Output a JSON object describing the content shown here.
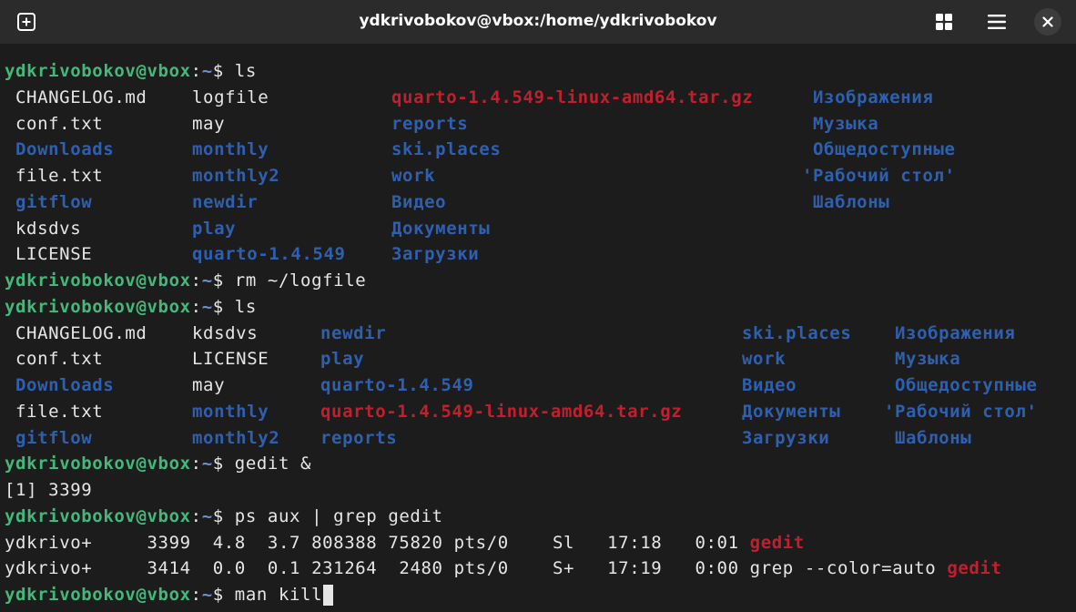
{
  "window": {
    "title": "ydkrivobokov@vbox:/home/ydkrivobokov"
  },
  "colors": {
    "prompt_user": "#44b87a",
    "prompt_path": "#6b8fd4",
    "text": "#e6e6e6",
    "directory": "#2f5faf",
    "archive": "#c0202e",
    "grep_highlight": "#c0202e",
    "background": "#1c1c1c"
  },
  "icons": {
    "new_tab": "new-tab-icon",
    "view_grid": "grid-icon",
    "menu": "hamburger-menu-icon",
    "close": "close-icon"
  },
  "terminal": {
    "lines": [
      {
        "kind": "prompt",
        "parts": [
          {
            "t": "ydkrivobokov@vbox",
            "c": "user"
          },
          {
            "t": ":",
            "c": "text"
          },
          {
            "t": "~",
            "c": "path"
          },
          {
            "t": "$ ls",
            "c": "text"
          }
        ]
      },
      {
        "kind": "ls",
        "parts": [
          {
            "t": "CHANGELOG.md",
            "c": "text",
            "col": 0
          },
          {
            "t": "logfile",
            "c": "text",
            "col": 1
          },
          {
            "t": "quarto-1.4.549-linux-amd64.tar.gz",
            "c": "arch",
            "col": 2
          },
          {
            "t": "Изображения",
            "c": "dir",
            "col": 3
          }
        ]
      },
      {
        "kind": "ls",
        "parts": [
          {
            "t": "conf.txt",
            "c": "text",
            "col": 0
          },
          {
            "t": "may",
            "c": "text",
            "col": 1
          },
          {
            "t": "reports",
            "c": "dir",
            "col": 2
          },
          {
            "t": "Музыка",
            "c": "dir",
            "col": 3
          }
        ]
      },
      {
        "kind": "ls",
        "parts": [
          {
            "t": "Downloads",
            "c": "dir",
            "col": 0
          },
          {
            "t": "monthly",
            "c": "dir",
            "col": 1
          },
          {
            "t": "ski.places",
            "c": "dir",
            "col": 2
          },
          {
            "t": "Общедоступные",
            "c": "dir",
            "col": 3
          }
        ]
      },
      {
        "kind": "ls",
        "parts": [
          {
            "t": "file.txt",
            "c": "text",
            "col": 0
          },
          {
            "t": "monthly2",
            "c": "dir",
            "col": 1
          },
          {
            "t": "work",
            "c": "dir",
            "col": 2
          },
          {
            "t": "'Рабочий стол'",
            "c": "dir",
            "col": 3,
            "quoted": true
          }
        ]
      },
      {
        "kind": "ls",
        "parts": [
          {
            "t": "gitflow",
            "c": "dir",
            "col": 0
          },
          {
            "t": "newdir",
            "c": "dir",
            "col": 1
          },
          {
            "t": "Видео",
            "c": "dir",
            "col": 2
          },
          {
            "t": "Шаблоны",
            "c": "dir",
            "col": 3
          }
        ]
      },
      {
        "kind": "ls",
        "parts": [
          {
            "t": "kdsdvs",
            "c": "text",
            "col": 0
          },
          {
            "t": "play",
            "c": "dir",
            "col": 1
          },
          {
            "t": "Документы",
            "c": "dir",
            "col": 2
          }
        ]
      },
      {
        "kind": "ls",
        "parts": [
          {
            "t": "LICENSE",
            "c": "text",
            "col": 0
          },
          {
            "t": "quarto-1.4.549",
            "c": "dir",
            "col": 1
          },
          {
            "t": "Загрузки",
            "c": "dir",
            "col": 2
          }
        ]
      },
      {
        "kind": "prompt",
        "parts": [
          {
            "t": "ydkrivobokov@vbox",
            "c": "user"
          },
          {
            "t": ":",
            "c": "text"
          },
          {
            "t": "~",
            "c": "path"
          },
          {
            "t": "$ rm ~/logfile",
            "c": "text"
          }
        ]
      },
      {
        "kind": "prompt",
        "parts": [
          {
            "t": "ydkrivobokov@vbox",
            "c": "user"
          },
          {
            "t": ":",
            "c": "text"
          },
          {
            "t": "~",
            "c": "path"
          },
          {
            "t": "$ ls",
            "c": "text"
          }
        ]
      },
      {
        "kind": "ls2",
        "parts": [
          {
            "t": "CHANGELOG.md",
            "c": "text",
            "col": 0
          },
          {
            "t": "kdsdvs",
            "c": "text",
            "col": 1
          },
          {
            "t": "newdir",
            "c": "dir",
            "col": 2
          },
          {
            "t": "ski.places",
            "c": "dir",
            "col": 3
          },
          {
            "t": "Изображения",
            "c": "dir",
            "col": 4
          }
        ]
      },
      {
        "kind": "ls2",
        "parts": [
          {
            "t": "conf.txt",
            "c": "text",
            "col": 0
          },
          {
            "t": "LICENSE",
            "c": "text",
            "col": 1
          },
          {
            "t": "play",
            "c": "dir",
            "col": 2
          },
          {
            "t": "work",
            "c": "dir",
            "col": 3
          },
          {
            "t": "Музыка",
            "c": "dir",
            "col": 4
          }
        ]
      },
      {
        "kind": "ls2",
        "parts": [
          {
            "t": "Downloads",
            "c": "dir",
            "col": 0
          },
          {
            "t": "may",
            "c": "text",
            "col": 1
          },
          {
            "t": "quarto-1.4.549",
            "c": "dir",
            "col": 2
          },
          {
            "t": "Видео",
            "c": "dir",
            "col": 3
          },
          {
            "t": "Общедоступные",
            "c": "dir",
            "col": 4
          }
        ]
      },
      {
        "kind": "ls2",
        "parts": [
          {
            "t": "file.txt",
            "c": "text",
            "col": 0
          },
          {
            "t": "monthly",
            "c": "dir",
            "col": 1
          },
          {
            "t": "quarto-1.4.549-linux-amd64.tar.gz",
            "c": "arch",
            "col": 2
          },
          {
            "t": "Документы",
            "c": "dir",
            "col": 3
          },
          {
            "t": "'Рабочий стол'",
            "c": "dir",
            "col": 4,
            "quoted": true
          }
        ]
      },
      {
        "kind": "ls2",
        "parts": [
          {
            "t": "gitflow",
            "c": "dir",
            "col": 0
          },
          {
            "t": "monthly2",
            "c": "dir",
            "col": 1
          },
          {
            "t": "reports",
            "c": "dir",
            "col": 2
          },
          {
            "t": "Загрузки",
            "c": "dir",
            "col": 3
          },
          {
            "t": "Шаблоны",
            "c": "dir",
            "col": 4
          }
        ]
      },
      {
        "kind": "prompt",
        "parts": [
          {
            "t": "ydkrivobokov@vbox",
            "c": "user"
          },
          {
            "t": ":",
            "c": "text"
          },
          {
            "t": "~",
            "c": "path"
          },
          {
            "t": "$ gedit &",
            "c": "text"
          }
        ]
      },
      {
        "kind": "plain",
        "parts": [
          {
            "t": "[1] 3399",
            "c": "text"
          }
        ]
      },
      {
        "kind": "prompt",
        "parts": [
          {
            "t": "ydkrivobokov@vbox",
            "c": "user"
          },
          {
            "t": ":",
            "c": "text"
          },
          {
            "t": "~",
            "c": "path"
          },
          {
            "t": "$ ps aux | grep gedit",
            "c": "text"
          }
        ]
      },
      {
        "kind": "plain",
        "parts": [
          {
            "t": "ydkrivo+     3399  4.8  3.7 808388 75820 pts/0    Sl   17:18   0:01 ",
            "c": "text"
          },
          {
            "t": "gedit",
            "c": "hl"
          }
        ]
      },
      {
        "kind": "plain",
        "parts": [
          {
            "t": "ydkrivo+     3414  0.0  0.1 231264  2480 pts/0    S+   17:19   0:00 grep --color=auto ",
            "c": "text"
          },
          {
            "t": "gedit",
            "c": "hl"
          }
        ]
      },
      {
        "kind": "prompt",
        "cursor": true,
        "parts": [
          {
            "t": "ydkrivobokov@vbox",
            "c": "user"
          },
          {
            "t": ":",
            "c": "text"
          },
          {
            "t": "~",
            "c": "path"
          },
          {
            "t": "$ man kill",
            "c": "text"
          }
        ]
      }
    ]
  }
}
